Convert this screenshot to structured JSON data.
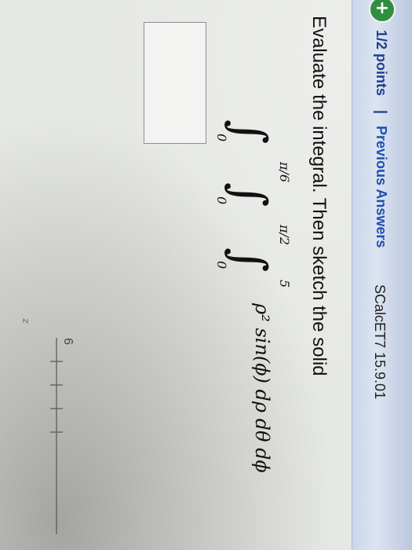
{
  "header": {
    "badge_icon": "plus-circle-icon",
    "badge_symbol": "+",
    "points": "1/2 points",
    "separator": "|",
    "previous_answers": "Previous Answers",
    "source": "SCalcET7 15.9.01"
  },
  "question": {
    "prompt": "Evaluate the integral. Then sketch the solid"
  },
  "integral": {
    "outer_upper": "π/6",
    "outer_lower": "0",
    "middle_upper": "π/2",
    "middle_lower": "0",
    "inner_upper": "5",
    "inner_lower": "0",
    "integrand": "ρ² sin(ϕ) dρ dθ dϕ"
  },
  "sketch": {
    "tick_label": "6",
    "axis_label": "z"
  },
  "colors": {
    "badge": "#2f8f3e",
    "link": "#1f4fae",
    "header_bg": "#dce4f1"
  }
}
